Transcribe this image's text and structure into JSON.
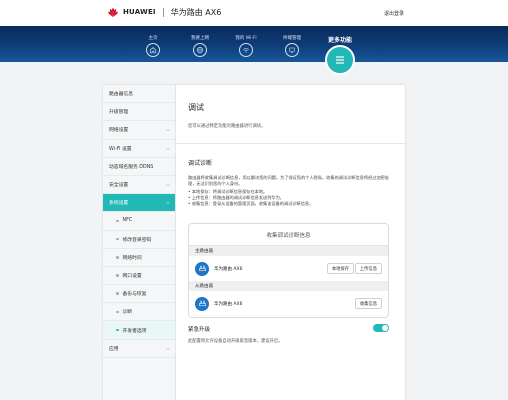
{
  "header": {
    "brand": "HUAWEI",
    "model": "华为路由 AX6",
    "logout": "退出登录"
  },
  "nav": {
    "items": [
      {
        "label": "主页",
        "icon": "home-icon"
      },
      {
        "label": "我要上网",
        "icon": "globe-icon"
      },
      {
        "label": "我的 Wi-Fi",
        "icon": "wifi-icon"
      },
      {
        "label": "终端管理",
        "icon": "device-icon"
      },
      {
        "label": "更多功能",
        "icon": "menu-icon"
      }
    ],
    "active_index": 4
  },
  "sidebar": {
    "items": [
      {
        "label": "路由器信息",
        "type": "section"
      },
      {
        "label": "升级管理",
        "type": "section"
      },
      {
        "label": "网络设置",
        "type": "section",
        "chevron": "chevron-down-icon"
      },
      {
        "label": "Wi-Fi 设置",
        "type": "section",
        "chevron": "chevron-down-icon"
      },
      {
        "label": "动态域名服务 DDNS",
        "type": "section"
      },
      {
        "label": "安全设置",
        "type": "section",
        "chevron": "chevron-down-icon"
      },
      {
        "label": "系统设置",
        "type": "section",
        "active": true,
        "chevron": "chevron-up-icon"
      },
      {
        "label": "NFC",
        "type": "sub"
      },
      {
        "label": "修改登录密码",
        "type": "sub"
      },
      {
        "label": "网络时间",
        "type": "sub"
      },
      {
        "label": "网口设置",
        "type": "sub"
      },
      {
        "label": "备份与恢复",
        "type": "sub"
      },
      {
        "label": "诊断",
        "type": "sub"
      },
      {
        "label": "开发者选项",
        "type": "sub",
        "current": true
      },
      {
        "label": "应用",
        "type": "section",
        "chevron": "chevron-down-icon"
      }
    ]
  },
  "content": {
    "title": "调试",
    "desc": "您可以通过特定功能对路由器进行调试。",
    "diag": {
      "title": "调试诊断",
      "desc": "路由器将收集调试诊断信息，用以解决您的问题。为了保证您的个人隐私，收集的调试诊断信息将经过加密处理，无法识别您的个人身份。",
      "bullets": [
        "本地保存：将调试诊断信息保存在本地。",
        "上传信息：将路由器的调试诊断信息发送到华为。",
        "收集信息：登录从设备的管理页面，收集该设备的调试诊断信息。"
      ],
      "box_title": "收集调试诊断信息",
      "main_group": "主路由器",
      "main_device": "华为路由 AX6",
      "save_local": "本地保存",
      "upload": "上传信息",
      "sub_group": "从路由器",
      "sub_device": "华为路由 AX6",
      "collect": "收集信息"
    },
    "upgrade": {
      "title": "紧急升级",
      "desc": "此配置将允许设备自动升级紧急版本，建议开启。",
      "enabled": true
    }
  },
  "colors": {
    "accent": "#21b8b6",
    "nav_dark": "#0a2a5c",
    "device_blue": "#1f74c8"
  }
}
